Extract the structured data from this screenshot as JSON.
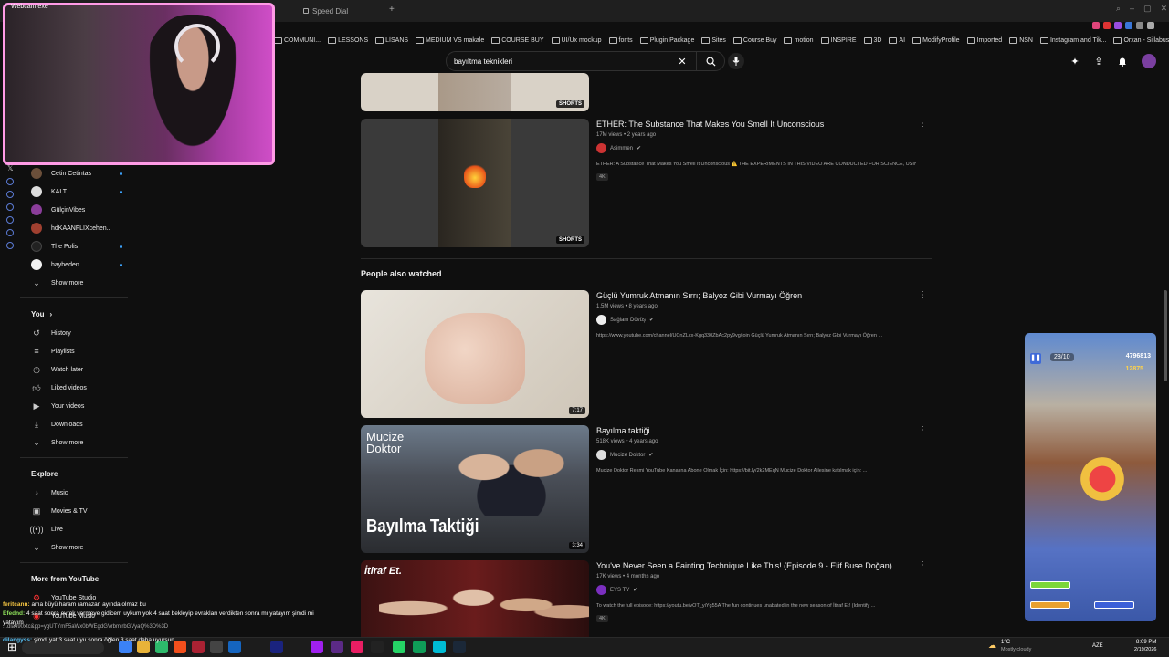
{
  "browser": {
    "webcam_title": "Webcam.exe",
    "tab_label": "Speed Dial",
    "bookmarks": [
      "COMMUNI...",
      "LESSONS",
      "LİSANS",
      "MEDIUM VS makale",
      "COURSE BUY",
      "UI/Ux mockup",
      "fonts",
      "Plugin Package",
      "Sites",
      "Course Buy",
      "motion",
      "INSPIRE",
      "3D",
      "AI",
      "ModifyProfile",
      "Imported",
      "NSN",
      "Instagram and Tik...",
      "Orxan - Sillabus h..."
    ]
  },
  "header": {
    "search_value": "bayıltma teknikleri"
  },
  "sidebar": {
    "subscriptions": [
      {
        "label": "Cetin Cetintas",
        "color": "#6b4f3a"
      },
      {
        "label": "KALT",
        "color": "#dddddd"
      },
      {
        "label": "GülçinVibes",
        "color": "#8a3d9a"
      },
      {
        "label": "hdKAANFLIXcehen...",
        "color": "#a04030"
      },
      {
        "label": "The Polis",
        "color": "#222222"
      },
      {
        "label": "haybeden...",
        "color": "#f0f0f0"
      }
    ],
    "show_more": "Show more",
    "you_heading": "You",
    "you_items": [
      {
        "label": "History",
        "icon": "history-icon"
      },
      {
        "label": "Playlists",
        "icon": "playlists-icon"
      },
      {
        "label": "Watch later",
        "icon": "watch-later-icon"
      },
      {
        "label": "Liked videos",
        "icon": "like-icon"
      },
      {
        "label": "Your videos",
        "icon": "your-videos-icon"
      },
      {
        "label": "Downloads",
        "icon": "download-icon"
      }
    ],
    "show_more_2": "Show more",
    "explore_heading": "Explore",
    "explore_items": [
      {
        "label": "Music",
        "icon": "music-icon"
      },
      {
        "label": "Movies & TV",
        "icon": "movies-icon"
      },
      {
        "label": "Live",
        "icon": "live-icon"
      }
    ],
    "show_more_3": "Show more",
    "more_heading": "More from YouTube",
    "more_items": [
      {
        "label": "YouTube Studio"
      },
      {
        "label": "YouTube Music"
      }
    ]
  },
  "feed": {
    "short1": {
      "badge": "SHORTS"
    },
    "video1": {
      "title": "ETHER: The Substance That Makes You Smell It Unconscious",
      "meta": "17M views • 2 years ago",
      "channel": "Asimmen",
      "desc": "ETHER: A Substance That Makes You Smell It Unconscious ⚠️ THE EXPERIMENTS IN THIS VIDEO ARE CONDUCTED FOR SCIENCE, USING ...",
      "badge": "4K",
      "shorts_badge": "SHORTS"
    },
    "section_heading": "People also watched",
    "video2": {
      "title": "Güçlü Yumruk Atmanın Sırrı; Balyoz Gibi Vurmayı Öğren",
      "meta": "1.5M views • 8 years ago",
      "channel": "Sağlam Dövüş",
      "desc": "https://www.youtube.com/channel/UCnZLcx-Kgq330ZbAc2py9vg/join Güçlü Yumruk Atmanın Sırrı; Balyoz Gibi Vurmayı Öğren ...",
      "duration": "7:17"
    },
    "video3": {
      "title": "Bayılma taktiği",
      "meta": "518K views • 4 years ago",
      "channel": "Mucize Doktor",
      "desc": "Mucize Doktor Resmi YouTube Kanalına Abone Olmak İçin: https://bit.ly/2k2MEqN Mucize Doktor Ailesine katılmak için: ...",
      "duration": "3:34",
      "thumb_text": "Bayılma Taktiği",
      "thumb_top": "Mucize Doktor"
    },
    "video4": {
      "title": "You've Never Seen a Fainting Technique Like This! (Episode 9 - Elif Buse Doğan)",
      "meta": "17K views • 4 months ago",
      "channel": "EYS TV",
      "desc": "To watch the full episode: https://youtu.be/vOT_yiYg55A The fun continues unabated in the new season of İtiraf Et! (Identify ...",
      "badge": "4K",
      "thumb_text": "İtiraf Et."
    }
  },
  "game": {
    "counter": "28/10",
    "score": "4796813",
    "coins": "12875"
  },
  "chat": [
    {
      "user": "feritcann:",
      "text": "ama büyü haram ramazan ayında olmaz bu"
    },
    {
      "user": "Efednd:",
      "text": "4 saat sonra evrak vermeye gidicem uykum yok 4 saat bekleyip evrakları verdikten sonra mı yatayım şimdi mi yatayım"
    },
    {
      "user": "",
      "text": "...dla490xtc&pp=ygUTYmF5aWx0bWEgdGVrbmlrbGVyaQ%3D%3D"
    },
    {
      "user": "dilangyss:",
      "text": "şimdi yat 3 saat uyu sonra öğlen 3 saat daha uyursun"
    }
  ],
  "taskbar": {
    "weather": "1°C",
    "weather_desc": "Mostly cloudy",
    "lang": "AZE",
    "time": "8:09 PM",
    "date": "2/19/2026"
  }
}
